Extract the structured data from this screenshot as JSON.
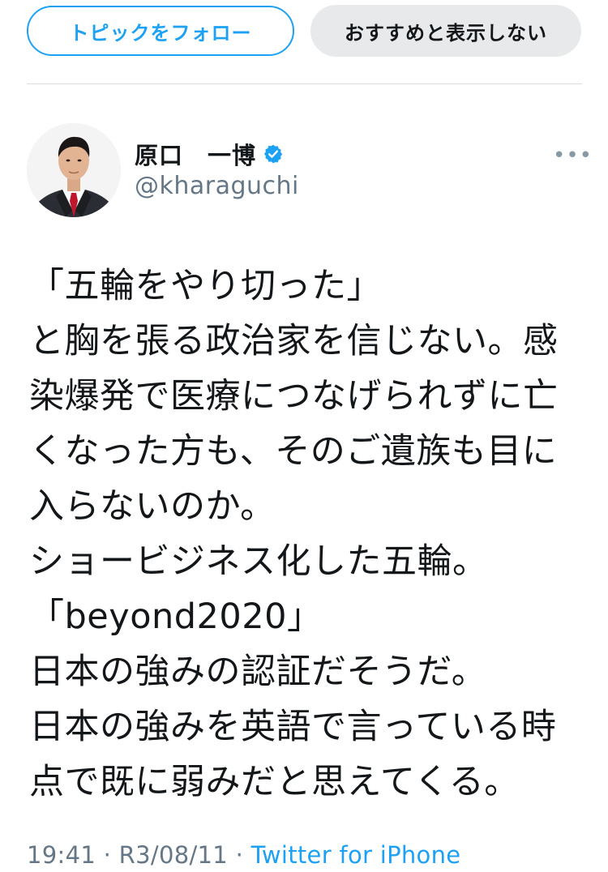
{
  "topbar": {
    "follow_topic_label": "トピックをフォロー",
    "not_interested_label": "おすすめと表示しない"
  },
  "author": {
    "display_name": "原口　一博",
    "handle": "@kharaguchi",
    "verified": true,
    "avatar": "person-photo",
    "more_icon": "more-horizontal-icon"
  },
  "tweet": {
    "lines": [
      "「五輪をやり切った」",
      "と胸を張る政治家を信じない。感",
      "染爆発で医療につなげられずに亡",
      "くなった方も、そのご遺族も目に",
      "入らないのか。",
      "ショービジネス化した五輪。",
      "「beyond2020」",
      "日本の強みの認証だそうだ。",
      "日本の強みを英語で言っている時",
      "点で既に弱みだと思えてくる。"
    ]
  },
  "meta": {
    "time": "19:41",
    "date": "R3/08/11",
    "separator": "·",
    "source": "Twitter for iPhone"
  },
  "colors": {
    "accent": "#1da1f2",
    "text": "#14171a",
    "secondary_text": "#657786",
    "dismiss_bg": "#e7e9eb"
  }
}
